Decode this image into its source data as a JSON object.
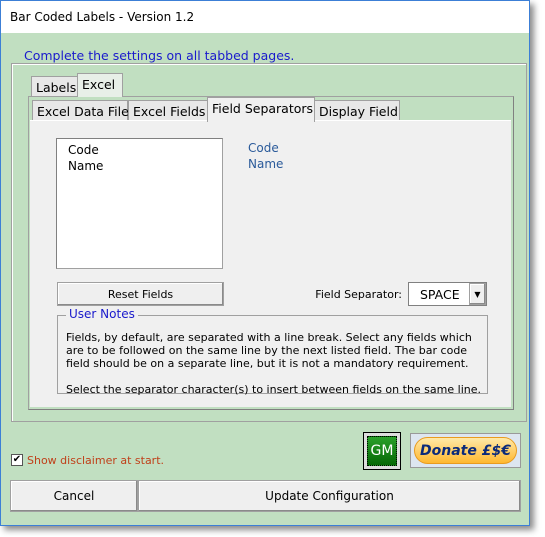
{
  "window": {
    "title": "Bar Coded Labels - Version 1.2"
  },
  "main_group": {
    "label": "Complete the settings on all tabbed pages."
  },
  "outer_tabs": [
    {
      "label": "Labels"
    },
    {
      "label": "Excel",
      "selected": true
    }
  ],
  "inner_tabs": [
    {
      "label": "Excel Data File"
    },
    {
      "label": "Excel Fields"
    },
    {
      "label": "Field Separators",
      "selected": true
    },
    {
      "label": "Display Field"
    }
  ],
  "field_list": {
    "items": [
      "Code",
      "Name"
    ]
  },
  "preview": {
    "lines": [
      "Code",
      "Name"
    ]
  },
  "reset_button": "Reset Fields",
  "separator": {
    "label": "Field Separator:",
    "value": "SPACE"
  },
  "user_notes": {
    "label": "User Notes",
    "paragraph1": "Fields, by default, are separated with a line break. Select any fields which are to be followed on the same line by the next listed field. The bar code field should  be on a separate line, but it is not a mandatory requirement.",
    "paragraph2": "Select the separator character(s) to insert between fields on the same line."
  },
  "disclaimer": {
    "label": "Show disclaimer at start.",
    "checked": true
  },
  "gm_button": "GM",
  "donate_button": "Donate £$€",
  "cancel_button": "Cancel",
  "update_button": "Update Configuration",
  "colors": {
    "background": "#c1dfc1",
    "group_label": "#1a1acc",
    "preview_text": "#2a5a9a",
    "disclaimer_text": "#c0401a",
    "gm_green": "#0a7a0a"
  }
}
